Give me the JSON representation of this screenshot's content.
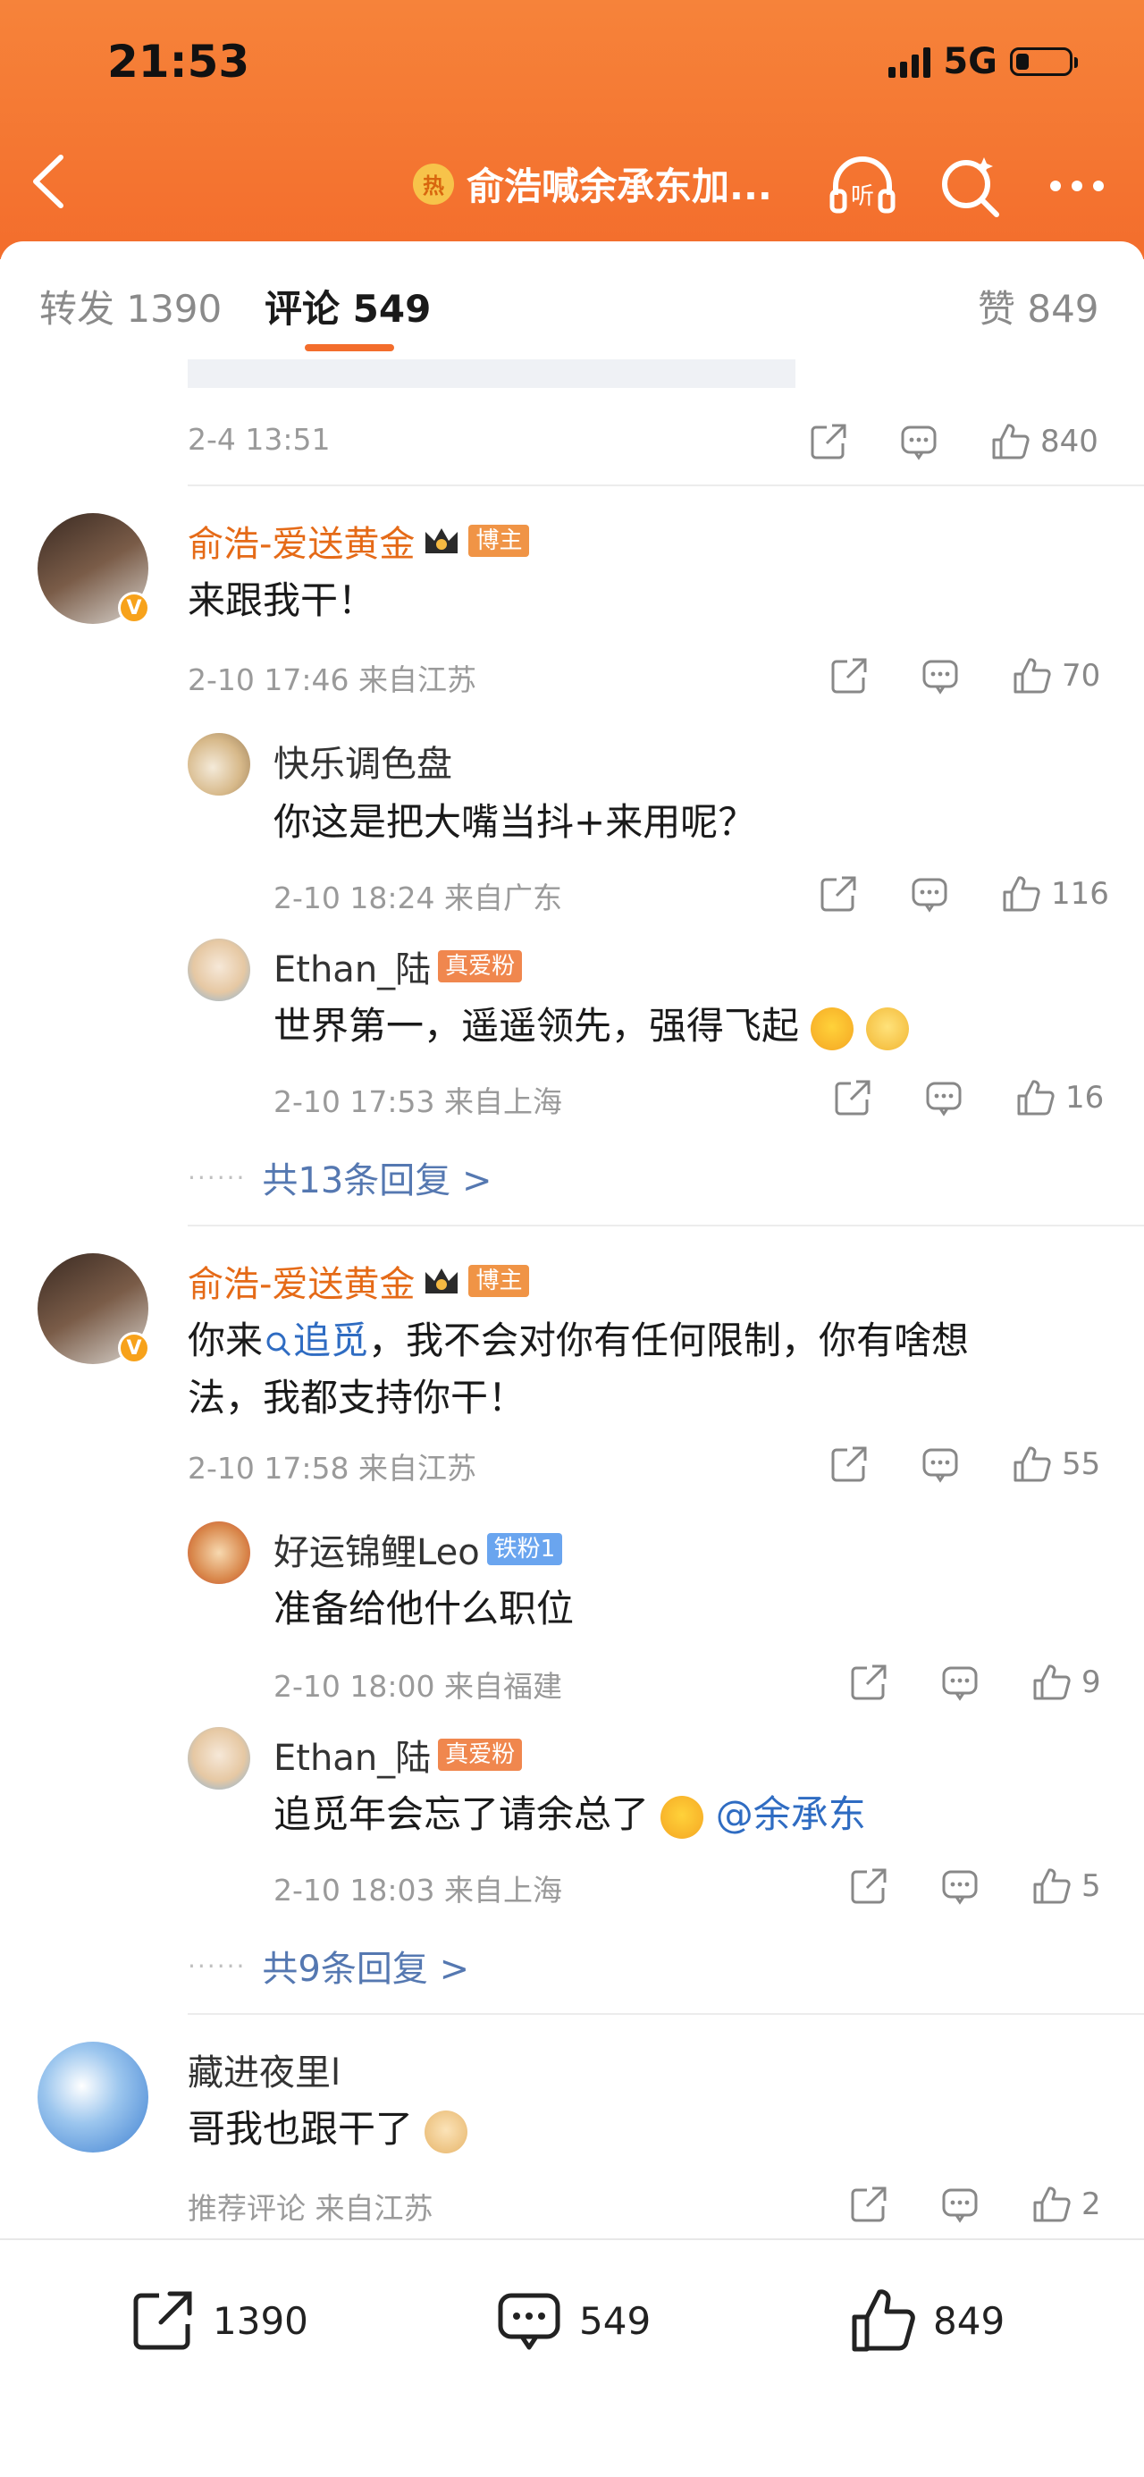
{
  "status": {
    "time": "21:53",
    "network": "5G"
  },
  "nav": {
    "hot_badge": "热",
    "title": "俞浩喊余承东加...",
    "listen_label": "听"
  },
  "tabs": {
    "repost": "转发 1390",
    "comment": "评论 549",
    "like": "赞 849"
  },
  "top_item": {
    "time": "2-4 13:51",
    "likes": "840"
  },
  "comments": [
    {
      "user": "俞浩-爱送黄金",
      "tag": "博主",
      "text": "来跟我干！",
      "meta": "2-10 17:46  来自江苏",
      "likes": "70",
      "replies": [
        {
          "user": "快乐调色盘",
          "text": "你这是把大嘴当抖+来用呢？",
          "meta": "2-10 18:24  来自广东",
          "likes": "116"
        },
        {
          "user": "Ethan_陆",
          "tag": "真爱粉",
          "text": "世界第一，遥遥领先，强得飞起",
          "meta": "2-10 17:53  来自上海",
          "likes": "16"
        }
      ],
      "more": "共13条回复 >"
    },
    {
      "user": "俞浩-爱送黄金",
      "tag": "博主",
      "text_pre": "你来",
      "text_link": "追觅",
      "text_post_line1": "，我不会对你有任何限制，你有啥想",
      "text_line2": "法，我都支持你干！",
      "meta": "2-10 17:58  来自江苏",
      "likes": "55",
      "replies": [
        {
          "user": "好运锦鲤Leo",
          "tag": "铁粉1",
          "text": "准备给他什么职位",
          "meta": "2-10 18:00  来自福建",
          "likes": "9"
        },
        {
          "user": "Ethan_陆",
          "tag": "真爱粉",
          "text": "追觅年会忘了请余总了",
          "mention": "@余承东",
          "meta": "2-10 18:03  来自上海",
          "likes": "5"
        }
      ],
      "more": "共9条回复 >"
    },
    {
      "user": "藏进夜里l",
      "text": "哥我也跟干了",
      "meta": "推荐评论  来自江苏",
      "likes": "2"
    }
  ],
  "more_dots": "······",
  "bottom_bar": {
    "repost": "1390",
    "comment": "549",
    "like": "849"
  }
}
